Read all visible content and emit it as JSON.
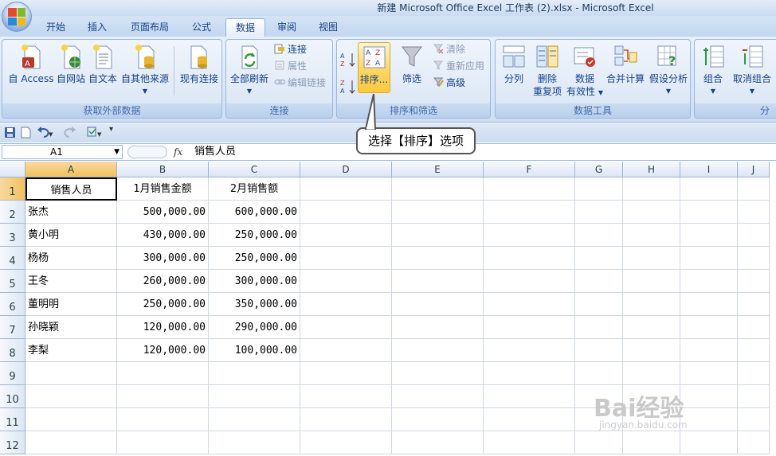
{
  "window": {
    "title": "新建 Microsoft Office Excel 工作表 (2).xlsx - Microsoft Excel"
  },
  "tabs": [
    "开始",
    "插入",
    "页面布局",
    "公式",
    "数据",
    "审阅",
    "视图"
  ],
  "active_tab": "数据",
  "ribbon": {
    "external": {
      "label": "获取外部数据",
      "access": "自 Access",
      "web": "自网站",
      "text": "自文本",
      "other": "自其他来源",
      "existing": "现有连接"
    },
    "connections": {
      "label": "连接",
      "refresh_all": "全部刷新",
      "connections": "连接",
      "properties": "属性",
      "edit_links": "编辑链接"
    },
    "sort_filter": {
      "label": "排序和筛选",
      "sort": "排序...",
      "filter": "筛选",
      "clear": "清除",
      "reapply": "重新应用",
      "advanced": "高级"
    },
    "data_tools": {
      "label": "数据工具",
      "text_to_columns": "分列",
      "remove_dup_1": "删除",
      "remove_dup_2": "重复项",
      "validation_1": "数据",
      "validation_2": "有效性",
      "consolidate": "合并计算",
      "whatif": "假设分析"
    },
    "outline": {
      "group": "组合",
      "ungroup": "取消组合",
      "label_partial": "分"
    }
  },
  "formula_bar": {
    "name_box": "A1",
    "fx": "fx",
    "value": "销售人员"
  },
  "callout": "选择【排序】选项",
  "columns": [
    "A",
    "B",
    "C",
    "D",
    "E",
    "F",
    "G",
    "H",
    "I",
    "J"
  ],
  "rows": [
    "1",
    "2",
    "3",
    "4",
    "5",
    "6",
    "7",
    "8",
    "9",
    "10",
    "11",
    "12"
  ],
  "table": {
    "headers": [
      "销售人员",
      "1月销售金额",
      "2月销售额"
    ],
    "data": [
      [
        "张杰",
        "500,000.00",
        "600,000.00"
      ],
      [
        "黄小明",
        "430,000.00",
        "250,000.00"
      ],
      [
        "杨杨",
        "300,000.00",
        "250,000.00"
      ],
      [
        "王冬",
        "260,000.00",
        "300,000.00"
      ],
      [
        "董明明",
        "250,000.00",
        "350,000.00"
      ],
      [
        "孙晓颖",
        "120,000.00",
        "290,000.00"
      ],
      [
        "李梨",
        "120,000.00",
        "100,000.00"
      ]
    ]
  },
  "watermark": {
    "main": "Bai经验",
    "sub": "jingyan.baidu.com"
  }
}
